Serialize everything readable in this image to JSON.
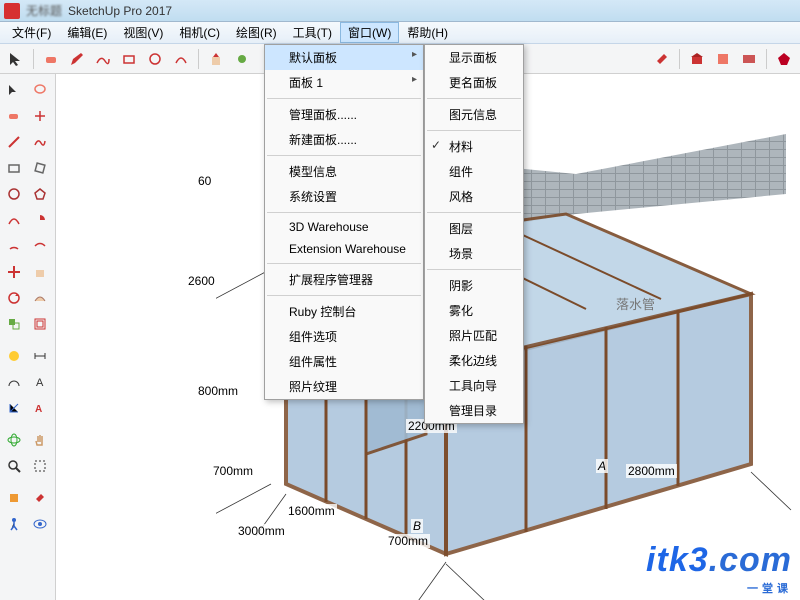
{
  "titlebar": {
    "doc": "无标题",
    "app": "SketchUp Pro 2017"
  },
  "menubar": [
    "文件(F)",
    "编辑(E)",
    "视图(V)",
    "相机(C)",
    "绘图(R)",
    "工具(T)",
    "窗口(W)",
    "帮助(H)"
  ],
  "active_menu_index": 6,
  "dropdown1": {
    "groups": [
      [
        {
          "label": "默认面板",
          "sub": true,
          "hover": true
        },
        {
          "label": "面板 1",
          "sub": true
        }
      ],
      [
        {
          "label": "管理面板......"
        },
        {
          "label": "新建面板......"
        }
      ],
      [
        {
          "label": "模型信息"
        },
        {
          "label": "系统设置"
        }
      ],
      [
        {
          "label": "3D Warehouse"
        },
        {
          "label": "Extension Warehouse"
        }
      ],
      [
        {
          "label": "扩展程序管理器"
        }
      ],
      [
        {
          "label": "Ruby 控制台"
        },
        {
          "label": "组件选项"
        },
        {
          "label": "组件属性"
        },
        {
          "label": "照片纹理"
        }
      ]
    ]
  },
  "dropdown2": {
    "groups": [
      [
        {
          "label": "显示面板"
        },
        {
          "label": "更名面板"
        }
      ],
      [
        {
          "label": "图元信息"
        }
      ],
      [
        {
          "label": "材料",
          "check": true
        },
        {
          "label": "组件"
        },
        {
          "label": "风格"
        }
      ],
      [
        {
          "label": "图层"
        },
        {
          "label": "场景"
        }
      ],
      [
        {
          "label": "阴影"
        },
        {
          "label": "雾化"
        },
        {
          "label": "照片匹配"
        },
        {
          "label": "柔化边线"
        },
        {
          "label": "工具向导"
        },
        {
          "label": "管理目录"
        }
      ]
    ]
  },
  "dimensions": {
    "d60": "60",
    "d2600": "2600",
    "d800": "800mm",
    "d700a": "700mm",
    "d1600": "1600mm",
    "d3000": "3000mm",
    "d700b": "700mm",
    "d2200": "2200mm",
    "d2800": "2800mm",
    "axisA": "A",
    "axisB": "B"
  },
  "annotation": "落水管",
  "watermark": {
    "main": "itk3",
    "dot": ".com",
    "sub": "一堂课"
  },
  "colors": {
    "accent": "#1e66e6",
    "menu_hover": "#cde6ff"
  }
}
